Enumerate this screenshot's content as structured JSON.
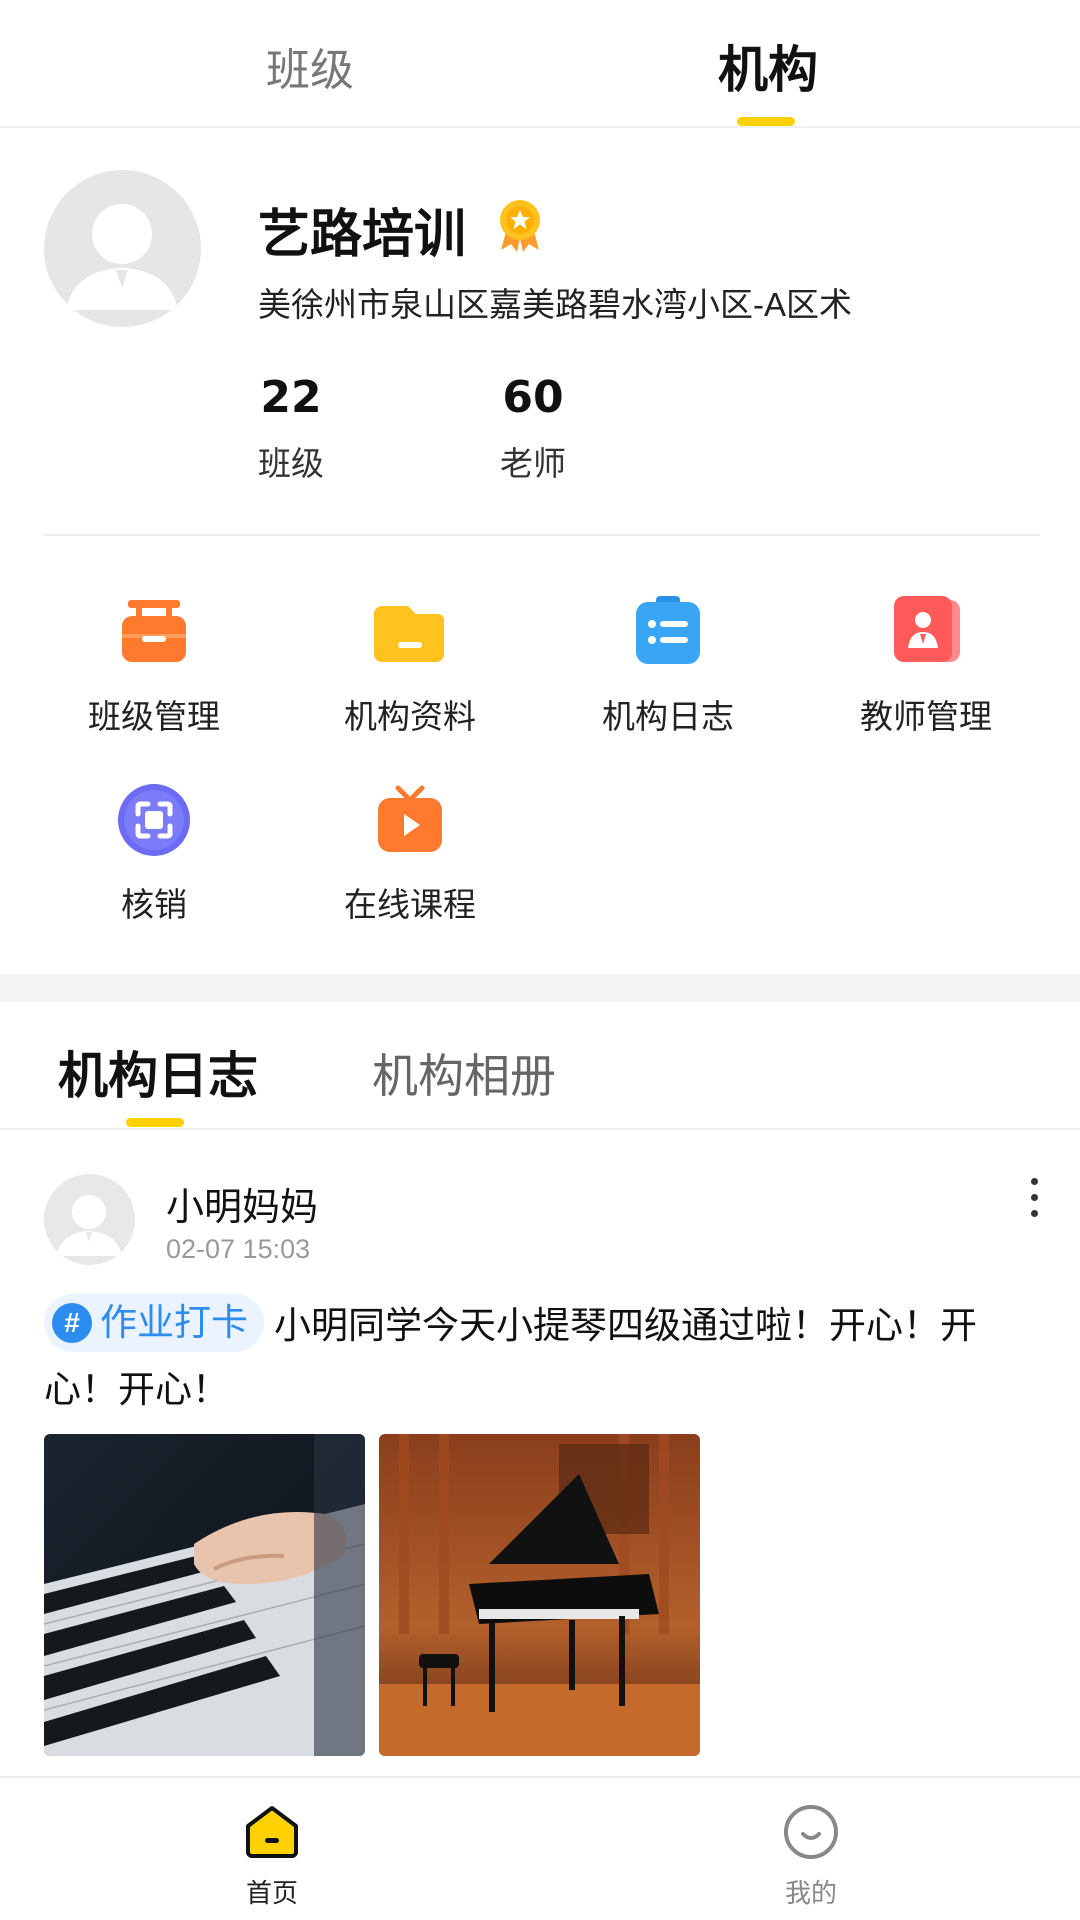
{
  "top_tabs": {
    "left": "班级",
    "right": "机构",
    "active": "机构"
  },
  "org": {
    "name": "艺路培训",
    "address": "美徐州市泉山区嘉美路碧水湾小区-A区术",
    "stats": [
      {
        "value": "22",
        "label": "班级"
      },
      {
        "value": "60",
        "label": "老师"
      }
    ]
  },
  "functions": [
    {
      "label": "班级管理",
      "icon": "class-management-icon",
      "color": "#FF7A2E"
    },
    {
      "label": "机构资料",
      "icon": "folder-icon",
      "color": "#FFC21F"
    },
    {
      "label": "机构日志",
      "icon": "journal-list-icon",
      "color": "#3AA5F5"
    },
    {
      "label": "教师管理",
      "icon": "teacher-badge-icon",
      "color": "#FF5A5A"
    },
    {
      "label": "核销",
      "icon": "scan-icon",
      "color": "#6B6BF5"
    },
    {
      "label": "在线课程",
      "icon": "tv-play-icon",
      "color": "#FF7A2E"
    }
  ],
  "journal_tabs": {
    "active": "机构日志",
    "other": "机构相册"
  },
  "post": {
    "author": "小明妈妈",
    "time": "02-07 15:03",
    "tag": "作业打卡",
    "text": "小明同学今天小提琴四级通过啦！开心！开心！开心！"
  },
  "bottom_nav": {
    "home": "首页",
    "me": "我的"
  },
  "colors": {
    "accent": "#FFD100",
    "tag_blue": "#2d8cf0"
  }
}
